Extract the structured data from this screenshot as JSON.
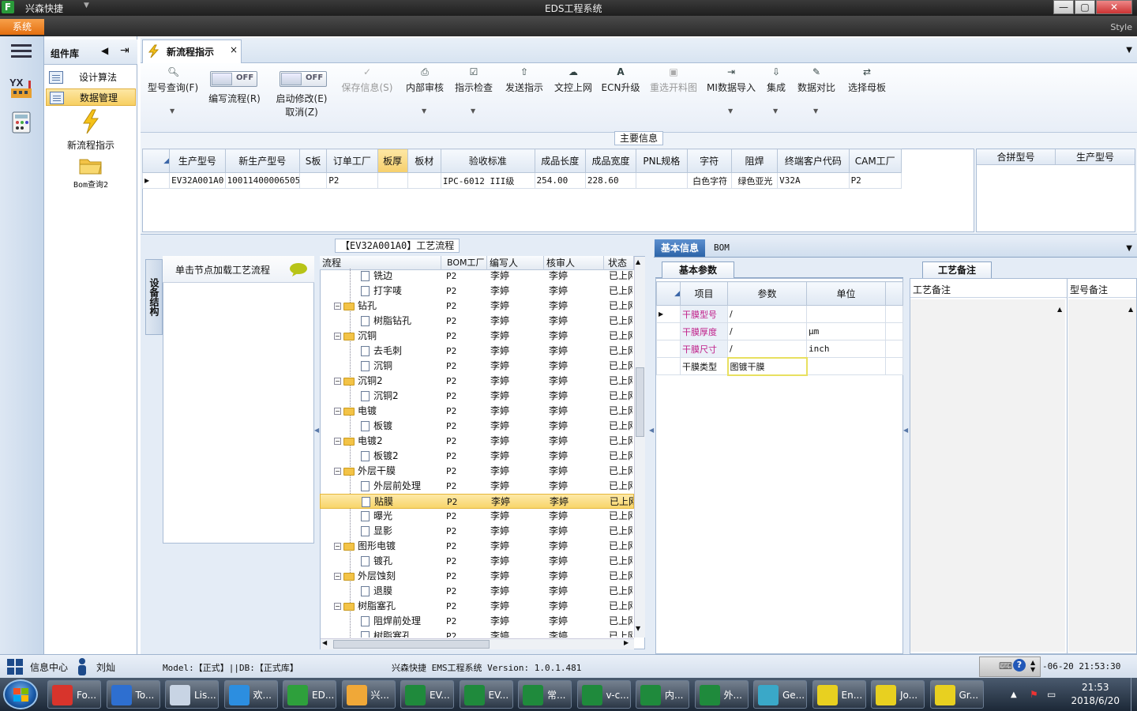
{
  "app": {
    "name": "兴森快捷",
    "window_title": "EDS工程系统",
    "style_label": "Style",
    "system_tab": "系统"
  },
  "window_buttons": {
    "minimize": "—",
    "maximize": "▢",
    "close": "✕"
  },
  "component_panel": {
    "title": "组件库",
    "items": [
      "设计算法",
      "数据管理"
    ],
    "icons": [
      {
        "label": "新流程指示"
      },
      {
        "label": "Bom查询2"
      }
    ]
  },
  "doc_tab": {
    "label": "新流程指示",
    "close": "×"
  },
  "toolbar": {
    "items": [
      {
        "label": "型号查询(F)",
        "icon": "🔍︎",
        "enabled": true
      },
      {
        "label": "编写流程(R)",
        "toggle": "OFF"
      },
      {
        "label": "启动修改(E)",
        "label2": "取消(Z)",
        "toggle": "OFF"
      },
      {
        "label": "保存信息(S)",
        "icon": "✓",
        "enabled": false
      },
      {
        "label": "内部审核",
        "icon": "⎙",
        "enabled": true
      },
      {
        "label": "指示检查",
        "icon": "☑",
        "enabled": true
      },
      {
        "label": "发送指示",
        "icon": "⇧",
        "enabled": true
      },
      {
        "label": "文控上网",
        "icon": "☁",
        "enabled": true
      },
      {
        "label": "ECN升级",
        "icon": "A",
        "enabled": true
      },
      {
        "label": "重选开料图",
        "icon": "▣",
        "enabled": false
      },
      {
        "label": "MI数据导入",
        "icon": "⇥",
        "enabled": true
      },
      {
        "label": "集成",
        "icon": "⇩",
        "enabled": true
      },
      {
        "label": "数据对比",
        "icon": "✎",
        "enabled": true
      },
      {
        "label": "选择母板",
        "icon": "⇄",
        "enabled": true
      }
    ]
  },
  "main_info": {
    "title": "主要信息",
    "columns": [
      "生产型号",
      "新生产型号",
      "S板",
      "订单工厂",
      "板厚",
      "板材",
      "验收标准",
      "成品长度",
      "成品宽度",
      "PNL规格",
      "字符",
      "阻焊",
      "终端客户代码",
      "CAM工厂"
    ],
    "row": [
      "EV32A001A0",
      "10011400006505",
      "",
      "P2",
      "",
      "",
      "IPC-6012 III级",
      "254.00",
      "228.60",
      "",
      "白色字符",
      "绿色亚光",
      "V32A",
      "P2"
    ],
    "side_columns": [
      "合拼型号",
      "生产型号"
    ]
  },
  "flow": {
    "title": "【EV32A001A0】工艺流程",
    "side_tab": "设备结构",
    "load_hint": "单击节点加载工艺流程",
    "columns": [
      "流程",
      "BOM工厂",
      "编写人",
      "核审人",
      "状态"
    ],
    "rows": [
      {
        "name": "铣边",
        "level": 2,
        "factory": "P2",
        "writer": "李婷",
        "reviewer": "李婷",
        "status": "已上网"
      },
      {
        "name": "打字唛",
        "level": 2,
        "factory": "P2",
        "writer": "李婷",
        "reviewer": "李婷",
        "status": "已上网"
      },
      {
        "name": "钻孔",
        "level": 1,
        "factory": "P2",
        "writer": "李婷",
        "reviewer": "李婷",
        "status": "已上网"
      },
      {
        "name": "树脂钻孔",
        "level": 2,
        "factory": "P2",
        "writer": "李婷",
        "reviewer": "李婷",
        "status": "已上网"
      },
      {
        "name": "沉铜",
        "level": 1,
        "factory": "P2",
        "writer": "李婷",
        "reviewer": "李婷",
        "status": "已上网"
      },
      {
        "name": "去毛刺",
        "level": 2,
        "factory": "P2",
        "writer": "李婷",
        "reviewer": "李婷",
        "status": "已上网"
      },
      {
        "name": "沉铜",
        "level": 2,
        "factory": "P2",
        "writer": "李婷",
        "reviewer": "李婷",
        "status": "已上网"
      },
      {
        "name": "沉铜2",
        "level": 1,
        "factory": "P2",
        "writer": "李婷",
        "reviewer": "李婷",
        "status": "已上网"
      },
      {
        "name": "沉铜2",
        "level": 2,
        "factory": "P2",
        "writer": "李婷",
        "reviewer": "李婷",
        "status": "已上网"
      },
      {
        "name": "电镀",
        "level": 1,
        "factory": "P2",
        "writer": "李婷",
        "reviewer": "李婷",
        "status": "已上网"
      },
      {
        "name": "板镀",
        "level": 2,
        "factory": "P2",
        "writer": "李婷",
        "reviewer": "李婷",
        "status": "已上网"
      },
      {
        "name": "电镀2",
        "level": 1,
        "factory": "P2",
        "writer": "李婷",
        "reviewer": "李婷",
        "status": "已上网"
      },
      {
        "name": "板镀2",
        "level": 2,
        "factory": "P2",
        "writer": "李婷",
        "reviewer": "李婷",
        "status": "已上网"
      },
      {
        "name": "外层干膜",
        "level": 1,
        "factory": "P2",
        "writer": "李婷",
        "reviewer": "李婷",
        "status": "已上网"
      },
      {
        "name": "外层前处理",
        "level": 2,
        "factory": "P2",
        "writer": "李婷",
        "reviewer": "李婷",
        "status": "已上网"
      },
      {
        "name": "贴膜",
        "level": 2,
        "factory": "P2",
        "writer": "李婷",
        "reviewer": "李婷",
        "status": "已上网",
        "selected": true
      },
      {
        "name": "曝光",
        "level": 2,
        "factory": "P2",
        "writer": "李婷",
        "reviewer": "李婷",
        "status": "已上网"
      },
      {
        "name": "显影",
        "level": 2,
        "factory": "P2",
        "writer": "李婷",
        "reviewer": "李婷",
        "status": "已上网"
      },
      {
        "name": "图形电镀",
        "level": 1,
        "factory": "P2",
        "writer": "李婷",
        "reviewer": "李婷",
        "status": "已上网"
      },
      {
        "name": "镀孔",
        "level": 2,
        "factory": "P2",
        "writer": "李婷",
        "reviewer": "李婷",
        "status": "已上网"
      },
      {
        "name": "外层蚀刻",
        "level": 1,
        "factory": "P2",
        "writer": "李婷",
        "reviewer": "李婷",
        "status": "已上网"
      },
      {
        "name": "退膜",
        "level": 2,
        "factory": "P2",
        "writer": "李婷",
        "reviewer": "李婷",
        "status": "已上网"
      },
      {
        "name": "树脂塞孔",
        "level": 1,
        "factory": "P2",
        "writer": "李婷",
        "reviewer": "李婷",
        "status": "已上网"
      },
      {
        "name": "阻焊前处理",
        "level": 2,
        "factory": "P2",
        "writer": "李婷",
        "reviewer": "李婷",
        "status": "已上网"
      },
      {
        "name": "树脂塞孔",
        "level": 2,
        "factory": "P2",
        "writer": "李婷",
        "reviewer": "李婷",
        "status": "已上网"
      }
    ]
  },
  "right": {
    "tabs": [
      "基本信息",
      "BOM"
    ],
    "param_tab": "基本参数",
    "param_columns": [
      "项目",
      "参数",
      "单位"
    ],
    "params": [
      {
        "item": "干膜型号",
        "value": "/",
        "unit": "",
        "highlight": true
      },
      {
        "item": "干膜厚度",
        "value": "/",
        "unit": "μm",
        "highlight": true
      },
      {
        "item": "干膜尺寸",
        "value": "/",
        "unit": "inch",
        "highlight": true
      },
      {
        "item": "干膜类型",
        "value": "图镀干膜",
        "unit": "",
        "highlight": false
      }
    ],
    "note_tab": "工艺备注",
    "note_columns": [
      "工艺备注",
      "型号备注"
    ]
  },
  "status": {
    "center": "信息中心",
    "user": "刘灿",
    "model": "Model:【正式】||DB:【正式库】",
    "version": "兴森快捷 EMS工程系统 Version: 1.0.1.481",
    "datetime": "-06-20 21:53:30"
  },
  "taskbar": {
    "items": [
      {
        "label": "Fo...",
        "color": "#d8342c"
      },
      {
        "label": "To...",
        "color": "#2e6fd0"
      },
      {
        "label": "Lis...",
        "color": "#c8d4e4"
      },
      {
        "label": "欢...",
        "color": "#2c8ee0"
      },
      {
        "label": "ED...",
        "color": "#2ea03c"
      },
      {
        "label": "兴...",
        "color": "#f0a838"
      },
      {
        "label": "EV...",
        "color": "#1f8a3c"
      },
      {
        "label": "EV...",
        "color": "#1f8a3c"
      },
      {
        "label": "常...",
        "color": "#1f8a3c"
      },
      {
        "label": "v-c...",
        "color": "#1f8a3c"
      },
      {
        "label": "内...",
        "color": "#1f8a3c"
      },
      {
        "label": "外...",
        "color": "#1f8a3c"
      },
      {
        "label": "Ge...",
        "color": "#3aa8c8"
      },
      {
        "label": "En...",
        "color": "#e8d020"
      },
      {
        "label": "Jo...",
        "color": "#e8d020"
      },
      {
        "label": "Gr...",
        "color": "#e8d020"
      }
    ],
    "time": "21:53",
    "date": "2018/6/20"
  },
  "colors": {
    "accent": "#2d64a8",
    "system_tab": "#e46f10",
    "selection": "#f8d56a",
    "param_highlight": "#c0208a"
  }
}
